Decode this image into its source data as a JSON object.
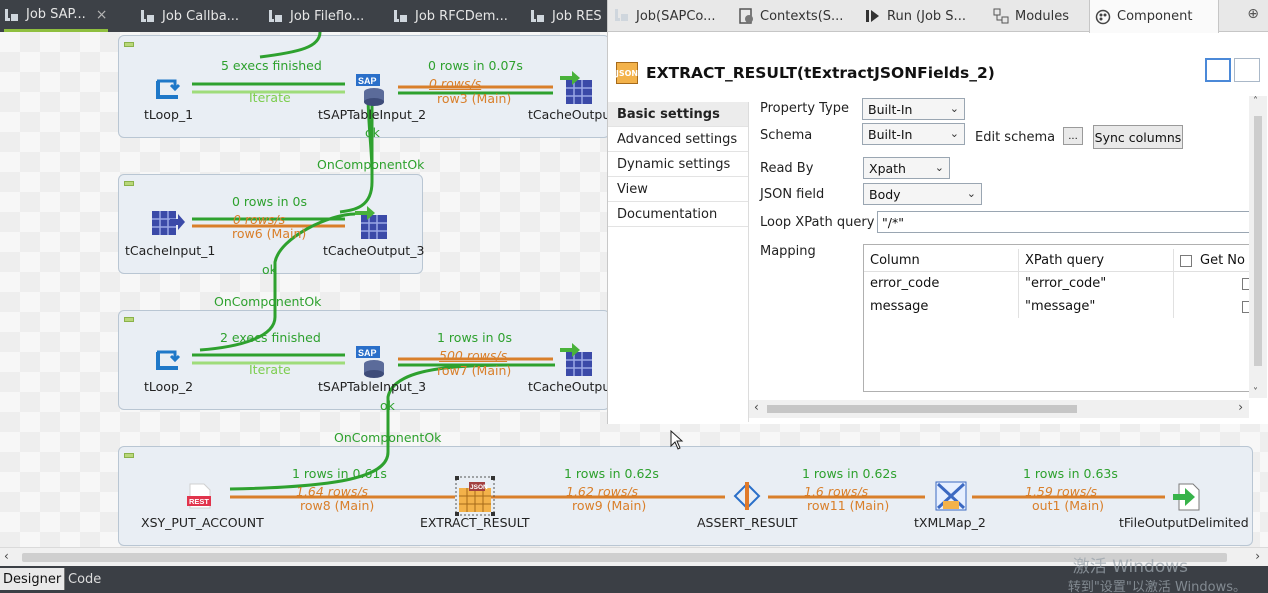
{
  "editor_tabs": [
    {
      "label": "Job SAP...",
      "close": "×"
    },
    {
      "label": "Job Callba..."
    },
    {
      "label": "Job Fileflo..."
    },
    {
      "label": "Job RFCDem..."
    },
    {
      "label": "Job RES"
    }
  ],
  "subjob1": {
    "tLoop": "tLoop_1",
    "sap": "tSAPTableInput_2",
    "cacheout": "tCacheOutpu",
    "iterate_stat": "5 execs finished",
    "iterate": "Iterate",
    "rows_stat": "0 rows in 0.07s",
    "rate": "0 rows/s",
    "row": "row3 (Main)",
    "ok": "ok"
  },
  "trigger1": "OnComponentOk",
  "subjob2": {
    "cachein": "tCacheInput_1",
    "cacheout": "tCacheOutput_3",
    "rows_stat": "0 rows in 0s",
    "rate": "0 rows/s",
    "row": "row6 (Main)",
    "ok": "ok"
  },
  "trigger2": "OnComponentOk",
  "subjob3": {
    "tLoop": "tLoop_2",
    "sap": "tSAPTableInput_3",
    "cacheout": "tCacheOutpu",
    "iterate_stat": "2 execs finished",
    "iterate": "Iterate",
    "rows_stat": "1 rows in 0s",
    "rate": "500 rows/s",
    "row": "row7 (Main)",
    "ok": "ok"
  },
  "trigger3": "OnComponentOk",
  "subjob4": {
    "rest": "XSY_PUT_ACCOUNT",
    "extract": "EXTRACT_RESULT",
    "assert": "ASSERT_RESULT",
    "xmlmap": "tXMLMap_2",
    "fileout": "tFileOutputDelimited",
    "rest_icon_text": "REST",
    "flows": [
      {
        "stat": "1 rows in 0.61s",
        "rate": "1.64 rows/s",
        "row": "row8 (Main)"
      },
      {
        "stat": "1 rows in 0.62s",
        "rate": "1.62 rows/s",
        "row": "row9 (Main)"
      },
      {
        "stat": "1 rows in 0.62s",
        "rate": "1.6 rows/s",
        "row": "row11 (Main)"
      },
      {
        "stat": "1 rows in 0.63s",
        "rate": "1.59 rows/s",
        "row": "out1 (Main)"
      }
    ]
  },
  "panel": {
    "tabs": [
      {
        "label": "Job(SAPCo..."
      },
      {
        "label": "Contexts(S..."
      },
      {
        "label": "Run (Job S..."
      },
      {
        "label": "Modules"
      },
      {
        "label": "Component"
      }
    ],
    "plus": "⊕",
    "title": "EXTRACT_RESULT(tExtractJSONFields_2)",
    "json_icon": "JSON",
    "nav": [
      {
        "label": "Basic settings",
        "selected": true
      },
      {
        "label": "Advanced settings"
      },
      {
        "label": "Dynamic settings"
      },
      {
        "label": "View"
      },
      {
        "label": "Documentation"
      }
    ],
    "property_type_label": "Property Type",
    "property_type_value": "Built-In",
    "schema_label": "Schema",
    "schema_value": "Built-In",
    "edit_schema_label": "Edit schema",
    "edit_schema_btn": "...",
    "sync_columns": "Sync columns",
    "read_by_label": "Read By",
    "read_by_value": "Xpath",
    "json_field_label": "JSON field",
    "json_field_value": "Body",
    "loop_label": "Loop XPath query",
    "loop_value": "\"/*\"",
    "mapping_label": "Mapping",
    "mapping_headers": [
      "Column",
      "XPath query",
      "Get No"
    ],
    "mapping_rows": [
      {
        "column": "error_code",
        "xpath": "\"error_code\""
      },
      {
        "column": "message",
        "xpath": "\"message\""
      }
    ]
  },
  "bottom_tabs": [
    {
      "label": "Designer"
    },
    {
      "label": "Code"
    }
  ],
  "watermark": {
    "line1": "激活 Windows",
    "line2": "转到\"设置\"以激活 Windows。"
  },
  "colors": {
    "green": "#2ea12e",
    "orange": "#d97f2a",
    "accent_tab": "#8fbf3f",
    "dark_bar": "#3d4147"
  }
}
